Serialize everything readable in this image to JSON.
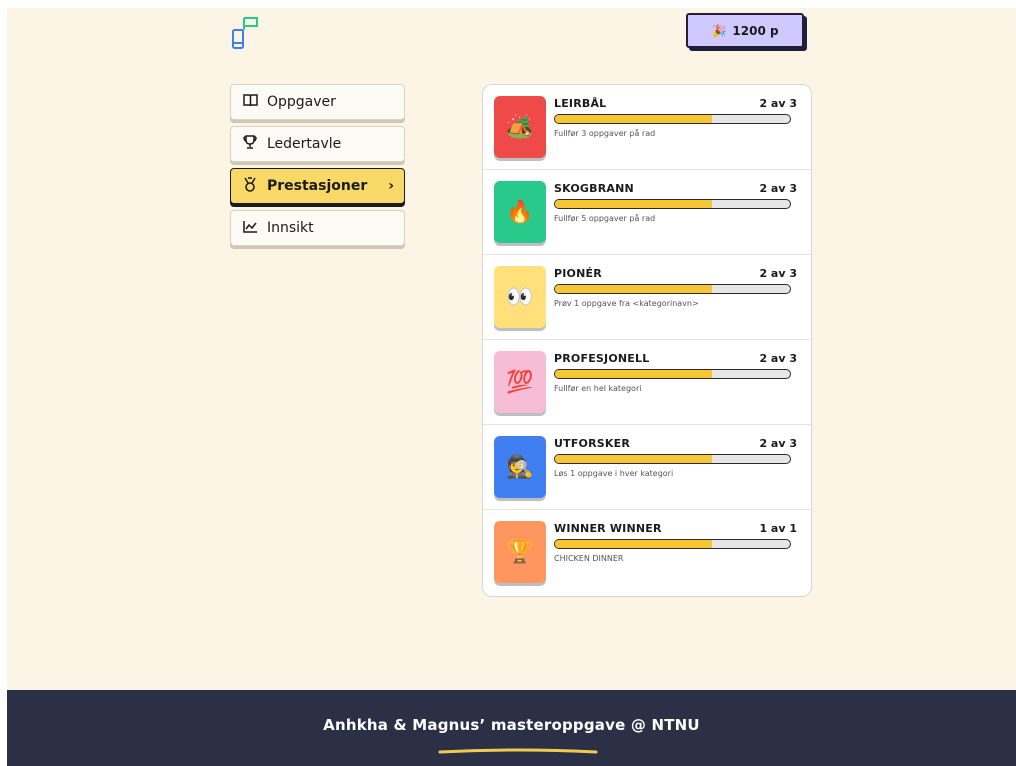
{
  "header": {
    "points_label": "1200 p",
    "points_emoji": "🎉"
  },
  "nav": {
    "items": [
      {
        "label": "Oppgaver",
        "icon": "book-icon"
      },
      {
        "label": "Ledertavle",
        "icon": "trophy-icon"
      },
      {
        "label": "Prestasjoner",
        "icon": "medal-icon",
        "active": true
      },
      {
        "label": "Innsikt",
        "icon": "chart-icon"
      }
    ],
    "active_chevron": "›"
  },
  "achievements": [
    {
      "title": "LEIRBÅL",
      "count": "2 av 3",
      "progress": 0.667,
      "desc": "Fullfør 3 oppgaver på rad",
      "emoji": "🏕️",
      "tile_color": "#ef4a4a"
    },
    {
      "title": "SKOGBRANN",
      "count": "2 av 3",
      "progress": 0.667,
      "desc": "Fullfør 5 oppgaver på rad",
      "emoji": "🔥",
      "tile_color": "#29c98b"
    },
    {
      "title": "PIONÉR",
      "count": "2 av 3",
      "progress": 0.667,
      "desc": "Prøv 1 oppgave fra <kategorinavn>",
      "emoji": "👀",
      "tile_color": "#ffe07a"
    },
    {
      "title": "PROFESJONELL",
      "count": "2 av 3",
      "progress": 0.667,
      "desc": "Fullfør en hel kategori",
      "emoji": "💯",
      "tile_color": "#f8bdd6"
    },
    {
      "title": "UTFORSKER",
      "count": "2 av 3",
      "progress": 0.667,
      "desc": "Løs 1 oppgave i hver kategori",
      "emoji": "🕵️",
      "tile_color": "#3f7ff2"
    },
    {
      "title": "WINNER WINNER",
      "count": "1 av 1",
      "progress": 0.667,
      "desc": "CHICKEN DINNER",
      "emoji": "🏆",
      "tile_color": "#ff955f"
    }
  ],
  "footer": {
    "text": "Anhkha & Magnus’ masteroppgave @ NTNU",
    "underline_color": "#f1c94e"
  }
}
